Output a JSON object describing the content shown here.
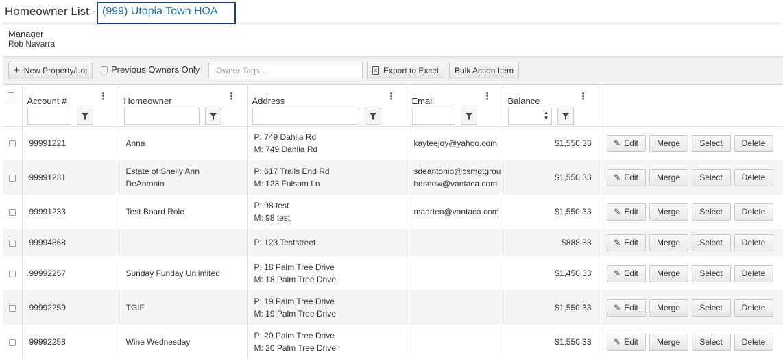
{
  "header": {
    "title": "Homeowner List -",
    "hoa_link": "(999) Utopia Town HOA",
    "manager_label": "Manager",
    "manager_name": "Rob Navarra"
  },
  "toolbar": {
    "new_property": "New Property/Lot",
    "previous_owners": "Previous Owners Only",
    "owner_tags_placeholder": "Owner Tags...",
    "export_excel": "Export to Excel",
    "bulk_action": "Bulk Action Item"
  },
  "columns": {
    "account": "Account #",
    "homeowner": "Homeowner",
    "address": "Address",
    "email": "Email",
    "balance": "Balance"
  },
  "row_actions": {
    "edit": "Edit",
    "merge": "Merge",
    "select": "Select",
    "delete": "Delete"
  },
  "rows": [
    {
      "account": "99991221",
      "homeowner": [
        "Anna",
        ""
      ],
      "address": [
        "P: 749 Dahlia Rd",
        "M: 749 Dahlia Rd"
      ],
      "email": [
        "kayteejoy@yahoo.com",
        ""
      ],
      "balance": "$1,550.33"
    },
    {
      "account": "99991231",
      "homeowner": [
        "Estate of Shelly Ann",
        "DeAntonio"
      ],
      "address": [
        "P: 617 Trails End Rd",
        "M: 123 Fulsom Ln"
      ],
      "email": [
        "sdeantonio@csmgtgrou",
        "bdsnow@vantaca.com"
      ],
      "balance": "$1,550.33"
    },
    {
      "account": "99991233",
      "homeowner": [
        "Test Board Role",
        ""
      ],
      "address": [
        "P: 98 test",
        "M: 98 test"
      ],
      "email": [
        "maarten@vantaca.com",
        ""
      ],
      "balance": "$1,550.33"
    },
    {
      "account": "99994868",
      "homeowner": [
        "",
        ""
      ],
      "address": [
        "P: 123 Teststreet",
        ""
      ],
      "email": [
        "",
        ""
      ],
      "balance": "$888.33"
    },
    {
      "account": "99992257",
      "homeowner": [
        "Sunday Funday Unlimited",
        ""
      ],
      "address": [
        "P: 18 Palm Tree Drive",
        "M: 18 Palm Tree Drive"
      ],
      "email": [
        "",
        ""
      ],
      "balance": "$1,450.33"
    },
    {
      "account": "99992259",
      "homeowner": [
        "TGIF",
        ""
      ],
      "address": [
        "P: 19 Palm Tree Drive",
        "M: 19 Palm Tree Drive"
      ],
      "email": [
        "",
        ""
      ],
      "balance": "$1,550.33"
    },
    {
      "account": "99992258",
      "homeowner": [
        "Wine Wednesday",
        ""
      ],
      "address": [
        "P: 20 Palm Tree Drive",
        "M: 20 Palm Tree Drive"
      ],
      "email": [
        "",
        ""
      ],
      "balance": "$1,550.33"
    }
  ]
}
